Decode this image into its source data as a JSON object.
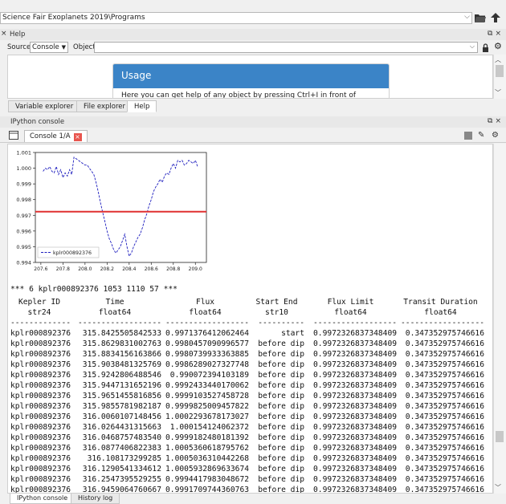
{
  "path": {
    "value": "Science Fair Exoplanets 2019\\Programs"
  },
  "help_pane": {
    "title": "Help",
    "source_label": "Source",
    "source_value": "Console",
    "object_label": "Object",
    "usage_title": "Usage",
    "usage_text": "Here you can get help of any object by pressing Ctrl+I in front of"
  },
  "tabs": [
    "Variable explorer",
    "File explorer",
    "Help"
  ],
  "console_pane": {
    "title": "IPython console",
    "tab_label": "Console 1/A"
  },
  "chart_data": {
    "type": "line",
    "xlim": [
      207.55,
      209.1
    ],
    "ylim": [
      0.994,
      1.001
    ],
    "xticks": [
      "207.6",
      "207.8",
      "208.0",
      "208.2",
      "208.4",
      "208.6",
      "208.8",
      "209.0"
    ],
    "yticks": [
      "0.994",
      "0.995",
      "0.996",
      "0.997",
      "0.998",
      "0.999",
      "1.000",
      "1.001"
    ],
    "legend": "kplr000892376",
    "threshold": 0.99723,
    "x": [
      207.62,
      207.64,
      207.66,
      207.68,
      207.7,
      207.72,
      207.74,
      207.76,
      207.78,
      207.8,
      207.82,
      207.84,
      207.86,
      207.88,
      207.9,
      207.92,
      207.94,
      207.96,
      207.98,
      208.0,
      208.02,
      208.04,
      208.06,
      208.08,
      208.1,
      208.12,
      208.14,
      208.16,
      208.18,
      208.2,
      208.22,
      208.24,
      208.26,
      208.28,
      208.3,
      208.32,
      208.34,
      208.36,
      208.38,
      208.4,
      208.42,
      208.44,
      208.46,
      208.48,
      208.5,
      208.52,
      208.54,
      208.56,
      208.58,
      208.6,
      208.62,
      208.64,
      208.66,
      208.68,
      208.7,
      208.72,
      208.74,
      208.76,
      208.78,
      208.8,
      208.82,
      208.84,
      208.86,
      208.88,
      208.9,
      208.92,
      208.94,
      208.96,
      208.98,
      209.0,
      209.02
    ],
    "y": [
      0.9998,
      1.0,
      0.9999,
      1.0001,
      0.9998,
      0.9997,
      1.0001,
      0.9996,
      0.9999,
      0.9994,
      0.9997,
      0.9995,
      0.9999,
      0.9996,
      1.0007,
      1.0006,
      1.0005,
      1.0004,
      1.0003,
      1.0002,
      1.0002,
      1.0,
      0.9998,
      0.9996,
      0.9991,
      0.9985,
      0.9978,
      0.9972,
      0.9966,
      0.996,
      0.9955,
      0.9952,
      0.9948,
      0.9946,
      0.9948,
      0.995,
      0.9954,
      0.9958,
      0.995,
      0.9944,
      0.9946,
      0.995,
      0.9953,
      0.9956,
      0.9958,
      0.9962,
      0.9967,
      0.9971,
      0.9976,
      0.998,
      0.9985,
      0.9988,
      0.999,
      0.9993,
      0.9991,
      0.9995,
      0.9997,
      0.9996,
      1.0,
      1.0003,
      1.0,
      1.0005,
      1.0004,
      1.0005,
      1.0002,
      1.0003,
      1.0005,
      1.0004,
      1.0003,
      1.0005,
      1.0001
    ]
  },
  "console_text": {
    "summary_line": "*** 6 kplr000892376 1053 1110 57 ***"
  },
  "table": {
    "headers": [
      "Kepler ID",
      "Time",
      "Flux",
      "Start End",
      "Flux Limit",
      "Transit Duration"
    ],
    "dtypes": [
      "str24",
      "float64",
      "float64",
      "str10",
      "float64",
      "float64"
    ],
    "separators": [
      "-------------",
      "------------------",
      "------------------",
      "----------",
      "------------------",
      "------------------"
    ],
    "rows": [
      [
        "kplr000892376",
        "315.8425505842533",
        "0.9971376412062464",
        "start",
        "0.9972326837348409",
        "0.347352975746616"
      ],
      [
        "kplr000892376",
        "315.8629831002763",
        "0.9980457090996577",
        "before dip",
        "0.9972326837348409",
        "0.347352975746616"
      ],
      [
        "kplr000892376",
        "315.8834156163866",
        "0.9980739933363885",
        "before dip",
        "0.9972326837348409",
        "0.347352975746616"
      ],
      [
        "kplr000892376",
        "315.9038481325769",
        "0.9986289027327748",
        "before dip",
        "0.9972326837348409",
        "0.347352975746616"
      ],
      [
        "kplr000892376",
        "315.9242806488546",
        "0.990072394103189",
        "before dip",
        "0.9972326837348409",
        "0.347352975746616"
      ],
      [
        "kplr000892376",
        "315.9447131652196",
        "0.9992433440170062",
        "before dip",
        "0.9972326837348409",
        "0.347352975746616"
      ],
      [
        "kplr000892376",
        "315.9651455816856",
        "0.9999103527458728",
        "before dip",
        "0.9972326837348409",
        "0.347352975746616"
      ],
      [
        "kplr000892376",
        "315.9855781982187",
        "0.9999825009457822",
        "before dip",
        "0.9972326837348409",
        "0.347352975746616"
      ],
      [
        "kplr000892376",
        "316.0060107148456",
        "1.0002293678173027",
        "before dip",
        "0.9972326837348409",
        "0.347352975746616"
      ],
      [
        "kplr000892376",
        "316.0264431315663",
        "1.000154124062372",
        "before dip",
        "0.9972326837348409",
        "0.347352975746616"
      ],
      [
        "kplr000892376",
        "316.0468757483540",
        "0.9999182480181392",
        "before dip",
        "0.9972326837348409",
        "0.347352975746616"
      ],
      [
        "kplr000892376",
        "316.0877406822383",
        "1.0005360618795762",
        "before dip",
        "0.9972326837348409",
        "0.347352975746616"
      ],
      [
        "kplr000892376",
        "316.108173299285",
        "1.0005036310442268",
        "before dip",
        "0.9972326837348409",
        "0.347352975746616"
      ],
      [
        "kplr000892376",
        "316.1290541334612",
        "1.0005932869633674",
        "before dip",
        "0.9972326837348409",
        "0.347352975746616"
      ],
      [
        "kplr000892376",
        "316.2547395529255",
        "0.9994417983048672",
        "before dip",
        "0.9972326837348409",
        "0.347352975746616"
      ],
      [
        "kplr000892376",
        "316.9459064760667",
        "0.9991709744360763",
        "before dip",
        "0.9972326837348409",
        "0.347352975746616"
      ]
    ]
  },
  "bottom_tabs": [
    "IPython console",
    "History log"
  ],
  "colors": {
    "accent": "#3b84c7",
    "line": "#1f1fbf",
    "threshold": "#e03030",
    "close": "#e8554e"
  }
}
